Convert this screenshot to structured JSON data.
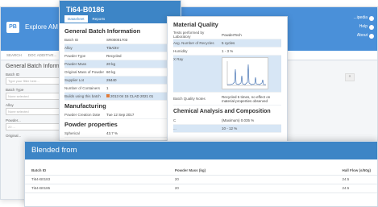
{
  "back": {
    "app_title": "Explore AM Mate",
    "logo_text": "PB",
    "right_items": [
      "...ipedia",
      "Help",
      "About"
    ],
    "tabs": [
      "SEARCH",
      "DOC ADDITIVE..."
    ],
    "section_title": "General Batch Informati",
    "fields": [
      {
        "label": "Batch ID",
        "placeholder": "Type your filter here..."
      },
      {
        "label": "Batch Type",
        "placeholder": "None selected"
      },
      {
        "label": "Alloy",
        "placeholder": "None selected"
      },
      {
        "label": "Powder...",
        "placeholder": "20 ..."
      },
      {
        "label": "Original...",
        "placeholder": ""
      }
    ],
    "scroll_glyph": "«"
  },
  "mid": {
    "title": "Ti64-B0186",
    "tabs": [
      "Datasheet",
      "Reports"
    ],
    "section1": "General Batch Information",
    "rows1": [
      {
        "k": "Batch ID",
        "v": "SR00001703"
      },
      {
        "k": "Alloy",
        "v": "Ti6Al4V"
      },
      {
        "k": "Powder Type",
        "v": "Recycled"
      },
      {
        "k": "Powder Mass",
        "v": "20  kg"
      },
      {
        "k": "Original Mass of Powder",
        "v": "60  kg"
      },
      {
        "k": "Supplier Lot",
        "v": "28440"
      },
      {
        "k": "Number of Containers",
        "v": "1"
      },
      {
        "k": "Builds using this batch",
        "v": "2013 04 15 CLAD 2021 01"
      }
    ],
    "section2": "Manufacturing",
    "rows2": [
      {
        "k": "Powder Creation Date",
        "v": "Tue 12 Sep 2017"
      }
    ],
    "section3": "Powder properties",
    "rows3": [
      {
        "k": "Spherical",
        "v": "43.7  %"
      }
    ]
  },
  "right": {
    "section1": "Material Quality",
    "rows": [
      {
        "k": "Tests performed by Laboratory",
        "v": "PowderTech"
      },
      {
        "k": "Avg. Number of Recycles",
        "v": "5  cycles"
      },
      {
        "k": "Humidity",
        "v": "1 - 3  %"
      },
      {
        "k": "X Ray",
        "v": ""
      },
      {
        "k": "Batch Quality Notes",
        "v": "Recycled 5 times, no effect on material properties observed"
      }
    ],
    "section2": "Chemical Analysis and Composition",
    "chem_rows": [
      {
        "k": "C",
        "v": "(Maximum) 0.035  %"
      },
      {
        "k": "...",
        "v": "10 - 12  %"
      }
    ]
  },
  "front": {
    "title": "Blended from",
    "columns": [
      "Batch ID",
      "Powder Mass (kg)",
      "Hall Flow (s/50g)"
    ],
    "rows": [
      [
        "Ti64-B0183",
        "20",
        "24.5"
      ],
      [
        "Ti64-B0185",
        "20",
        "24.5"
      ]
    ]
  },
  "colors": {
    "header_blue": "#3d85c6",
    "back_header_blue": "#4a90d9",
    "highlight": "#d7e6f5",
    "warning": "#e07b39"
  }
}
